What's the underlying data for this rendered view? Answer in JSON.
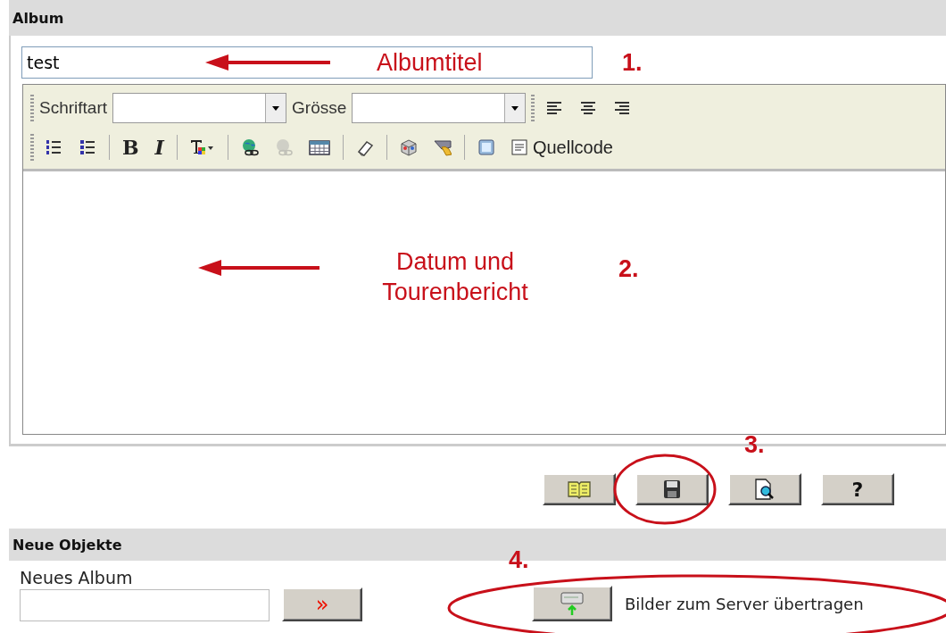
{
  "album": {
    "title": "Album",
    "title_field": {
      "value": "test"
    },
    "toolbar": [
      {
        "items": [
          {
            "kind": "grip"
          },
          {
            "kind": "text",
            "label": "Schriftart"
          },
          {
            "kind": "select"
          },
          {
            "kind": "text",
            "label": "Grösse"
          },
          {
            "kind": "select"
          },
          {
            "kind": "grip"
          },
          {
            "kind": "icon",
            "disabled": false
          },
          {
            "kind": "icon",
            "disabled": false
          },
          {
            "kind": "icon",
            "disabled": false
          }
        ]
      },
      {
        "items": [
          {
            "kind": "grip"
          },
          {
            "kind": "icon",
            "disabled": false
          },
          {
            "kind": "icon",
            "disabled": false
          },
          {
            "kind": "sep"
          },
          {
            "kind": "char",
            "label": "B"
          },
          {
            "kind": "char",
            "label": "I"
          },
          {
            "kind": "sep"
          },
          {
            "kind": "icon",
            "disabled": false
          },
          {
            "kind": "sep"
          },
          {
            "kind": "icon",
            "disabled": false
          },
          {
            "kind": "icon",
            "disabled": true
          },
          {
            "kind": "icon",
            "disabled": false
          },
          {
            "kind": "sep"
          },
          {
            "kind": "icon",
            "disabled": false
          },
          {
            "kind": "sep"
          },
          {
            "kind": "icon",
            "disabled": false
          },
          {
            "kind": "icon",
            "disabled": false
          },
          {
            "kind": "sep"
          },
          {
            "kind": "icon",
            "disabled": false
          },
          {
            "kind": "button",
            "label": "Quellcode"
          }
        ]
      }
    ]
  },
  "actions": [
    {
      "kind": "icon"
    },
    {
      "kind": "icon"
    },
    {
      "kind": "icon"
    },
    {
      "kind": "text",
      "label": "?"
    }
  ],
  "new_objects": {
    "title": "Neue Objekte",
    "new_album_label": "Neues Album",
    "submit_label": "»",
    "upload_label": "Bilder zum Server übertragen"
  },
  "annotations": [
    {
      "text": "Albumtitel"
    },
    {
      "text": "1."
    },
    {
      "text": "Datum und Tourenbericht"
    },
    {
      "text": "2."
    },
    {
      "text": "3."
    },
    {
      "text": "4."
    }
  ]
}
